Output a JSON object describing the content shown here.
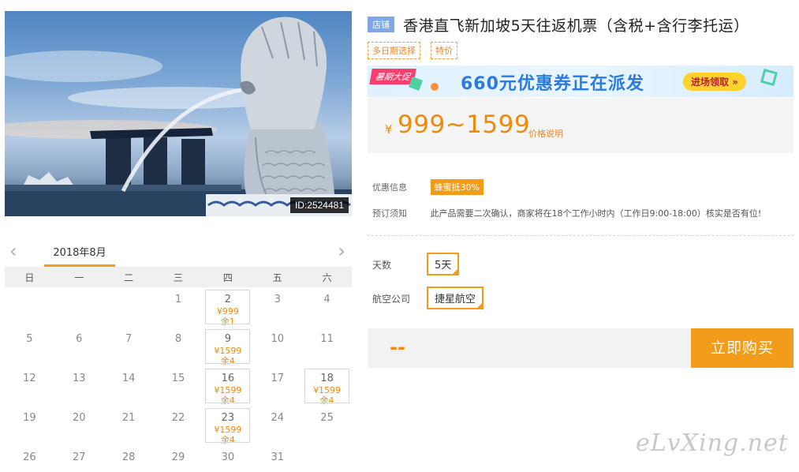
{
  "hero": {
    "image_label": "ID:2524481"
  },
  "product": {
    "shop_badge": "店铺",
    "title": "香港直飞新加坡5天往返机票（含税+含行李托运）",
    "tags": [
      "多日期选择",
      "特价"
    ]
  },
  "banner": {
    "flag": "暑期大促",
    "text": "660元优惠券正在派发",
    "button": "进场领取 »"
  },
  "price": {
    "symbol": "¥",
    "range": "999~1599",
    "note": "价格说明"
  },
  "info": {
    "promo_label": "优惠信息",
    "promo_tag": "蜂蜜抵30%",
    "notice_label": "预订须知",
    "notice_text": "此产品需要二次确认，商家将在18个工作小时内（工作日9:00-18:00）核实是否有位!"
  },
  "options": {
    "days_label": "天数",
    "days_value": "5天",
    "airline_label": "航空公司",
    "airline_value": "捷星航空"
  },
  "buy": {
    "total": "--",
    "button": "立即购买"
  },
  "calendar": {
    "prev": "‹",
    "next": "›",
    "month": "2018年8月",
    "weekdays": [
      "日",
      "一",
      "二",
      "三",
      "四",
      "五",
      "六"
    ],
    "leading_blanks": 3,
    "days": [
      {
        "d": "1"
      },
      {
        "d": "2",
        "price": "¥999",
        "remain": "余1"
      },
      {
        "d": "3"
      },
      {
        "d": "4"
      },
      {
        "d": "5"
      },
      {
        "d": "6"
      },
      {
        "d": "7"
      },
      {
        "d": "8"
      },
      {
        "d": "9",
        "price": "¥1599",
        "remain": "余4"
      },
      {
        "d": "10"
      },
      {
        "d": "11"
      },
      {
        "d": "12"
      },
      {
        "d": "13"
      },
      {
        "d": "14"
      },
      {
        "d": "15"
      },
      {
        "d": "16",
        "price": "¥1599",
        "remain": "余4"
      },
      {
        "d": "17"
      },
      {
        "d": "18",
        "price": "¥1599",
        "remain": "余4"
      },
      {
        "d": "19"
      },
      {
        "d": "20"
      },
      {
        "d": "21"
      },
      {
        "d": "22"
      },
      {
        "d": "23",
        "price": "¥1599",
        "remain": "余4"
      },
      {
        "d": "24"
      },
      {
        "d": "25"
      },
      {
        "d": "26"
      },
      {
        "d": "27"
      },
      {
        "d": "28"
      },
      {
        "d": "29"
      },
      {
        "d": "30"
      },
      {
        "d": "31"
      }
    ]
  },
  "watermark": "eLvXing.net",
  "colors": {
    "accent": "#f39c1c",
    "price": "#f08a0b",
    "shop_badge": "#7ea7e4"
  }
}
